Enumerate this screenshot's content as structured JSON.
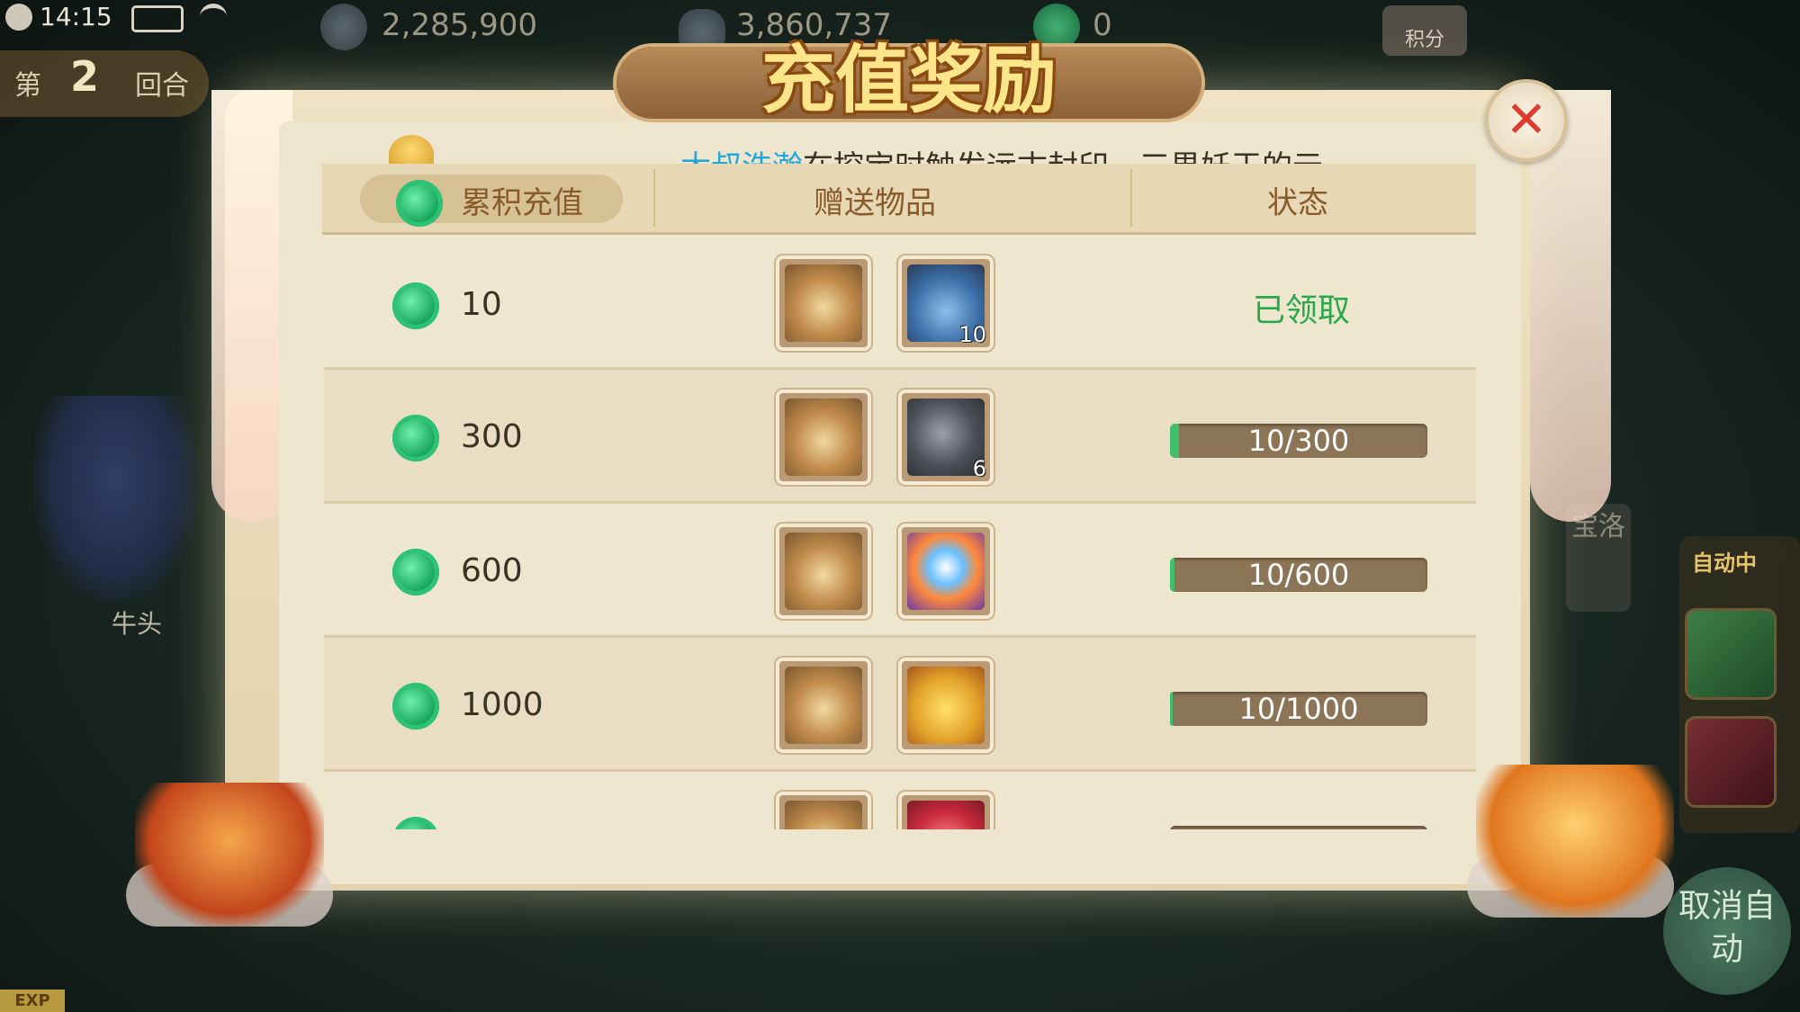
{
  "status_bar": {
    "time": "14:15"
  },
  "currencies": [
    {
      "icon": "tribute-coin-icon",
      "value": "2,285,900"
    },
    {
      "icon": "silver-ingot-icon",
      "value": "3,860,737"
    },
    {
      "icon": "jade-icon",
      "value": "0"
    }
  ],
  "round": {
    "prefix": "第",
    "number": "2",
    "suffix": "回合"
  },
  "score_button": "积分",
  "character_name": "牛头",
  "exp_label": "EXP",
  "right_tab_text": "宝洛",
  "auto": {
    "label": "自动中",
    "cancel": "取消自动"
  },
  "modal": {
    "title": "充值奖励",
    "marquee": {
      "player": "太叔浩瀚",
      "message": "在挖宝时触发远古封印，三界妖王的元"
    },
    "headers": {
      "cumulative": "累积充值",
      "gifts": "赠送物品",
      "status": "状态"
    },
    "rows": [
      {
        "amount": "10",
        "items": [
          {
            "icon": "silver-bag-icon",
            "qty": ""
          },
          {
            "icon": "jade-vase-icon",
            "qty": "10"
          }
        ],
        "status_type": "claimed",
        "status_text": "已领取"
      },
      {
        "amount": "300",
        "items": [
          {
            "icon": "silver-bag-icon",
            "qty": ""
          },
          {
            "icon": "dark-ore-icon",
            "qty": "6"
          }
        ],
        "status_type": "progress",
        "status_text": "10/300",
        "progress": 0.0333
      },
      {
        "amount": "600",
        "items": [
          {
            "icon": "silver-bag-icon",
            "qty": ""
          },
          {
            "icon": "crystal-orb-icon",
            "qty": ""
          }
        ],
        "status_type": "progress",
        "status_text": "10/600",
        "progress": 0.0167
      },
      {
        "amount": "1000",
        "items": [
          {
            "icon": "silver-bag-icon",
            "qty": ""
          },
          {
            "icon": "gold-bag-icon",
            "qty": ""
          }
        ],
        "status_type": "progress",
        "status_text": "10/1000",
        "progress": 0.01
      },
      {
        "amount": "",
        "items": [
          {
            "icon": "silver-bag-icon",
            "qty": ""
          },
          {
            "icon": "red-bag-icon",
            "qty": ""
          }
        ],
        "status_type": "progress",
        "status_text": "",
        "progress": 0
      }
    ],
    "close_icon": "close-icon"
  },
  "colors": {
    "claimed_green": "#27a849",
    "marquee_name": "#23a7d8",
    "title_gold": "#ffe58a"
  }
}
